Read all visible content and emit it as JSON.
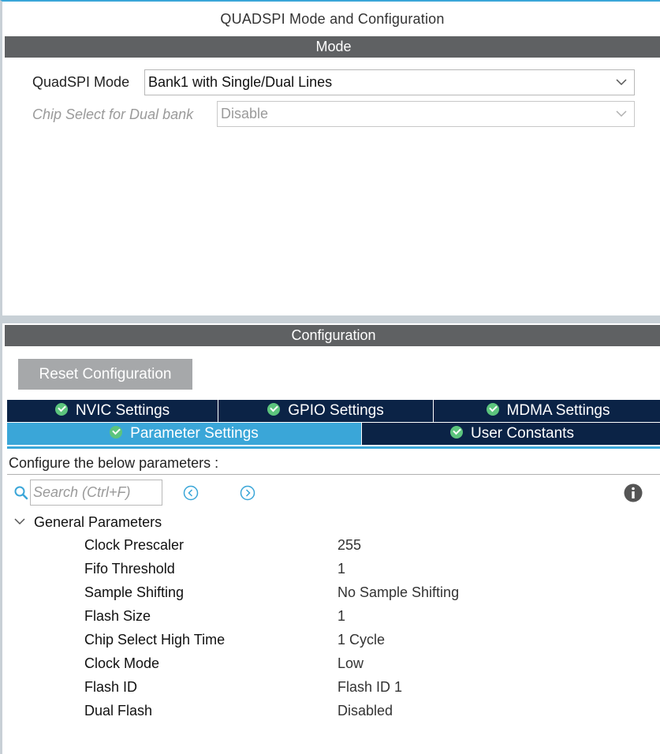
{
  "window": {
    "title": "QUADSPI Mode and Configuration"
  },
  "mode": {
    "section_title": "Mode",
    "quadspi_mode": {
      "label": "QuadSPI Mode",
      "value": "Bank1 with Single/Dual Lines"
    },
    "chip_select": {
      "label": "Chip Select for Dual bank",
      "value": "Disable",
      "disabled": true
    }
  },
  "configuration": {
    "section_title": "Configuration",
    "reset_label": "Reset Configuration",
    "tabs": [
      {
        "label": "NVIC Settings",
        "active": false
      },
      {
        "label": "GPIO Settings",
        "active": false
      },
      {
        "label": "MDMA Settings",
        "active": false
      },
      {
        "label": "Parameter Settings",
        "active": true
      },
      {
        "label": "User Constants",
        "active": false
      }
    ],
    "configure_text": "Configure the below parameters :",
    "search": {
      "placeholder": "Search (Ctrl+F)"
    },
    "group": {
      "title": "General Parameters",
      "params": [
        {
          "name": "Clock Prescaler",
          "value": "255"
        },
        {
          "name": "Fifo Threshold",
          "value": "1"
        },
        {
          "name": "Sample Shifting",
          "value": "No Sample Shifting"
        },
        {
          "name": "Flash Size",
          "value": "1"
        },
        {
          "name": "Chip Select High Time",
          "value": "1 Cycle"
        },
        {
          "name": "Clock Mode",
          "value": "Low"
        },
        {
          "name": "Flash ID",
          "value": "Flash ID 1"
        },
        {
          "name": "Dual Flash",
          "value": "Disabled"
        }
      ]
    }
  },
  "colors": {
    "tab_dark": "#0b2346",
    "tab_active": "#3aa6d8",
    "section_bar": "#5f6163",
    "check_green": "#5cc47d",
    "button_gray": "#a6a8aa"
  },
  "icons": {
    "search": "search-icon",
    "prev": "previous-icon",
    "next": "next-icon",
    "info": "info-icon",
    "tick": "check-circle-icon",
    "chevron": "chevron-down-icon"
  }
}
